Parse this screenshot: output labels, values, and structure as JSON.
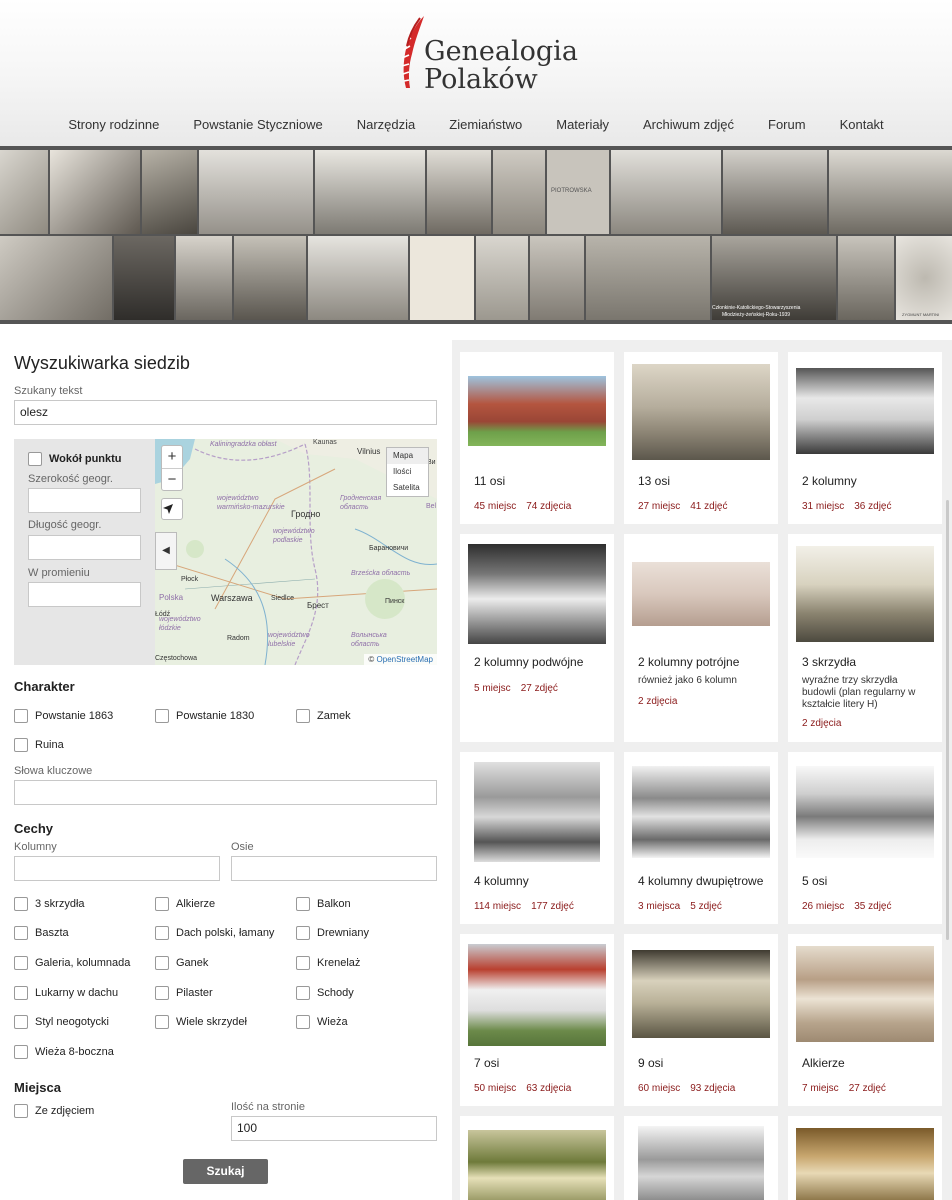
{
  "brand": {
    "line1": "Genealogia",
    "line2": "Polaków",
    "accent": "#d42a2a"
  },
  "nav": [
    "Strony rodzinne",
    "Powstanie Styczniowe",
    "Narzędzia",
    "Ziemiaństwo",
    "Materiały",
    "Archiwum zdjęć",
    "Forum",
    "Kontakt"
  ],
  "banner": {
    "caption_line1": "Członkinie-Katolickiego-Stowarzyszenia",
    "caption_line2": "Młodzieży-żeńskiej-Roku-1939",
    "stone_text": "PIOTROWSKA",
    "portrait_caption": "ZYGMUNT MARTINI"
  },
  "search": {
    "title": "Wyszukiwarka siedzib",
    "text_label": "Szukany tekst",
    "text_value": "olesz",
    "around_point": "Wokół punktu",
    "lat_label": "Szerokość geogr.",
    "lon_label": "Długość geogr.",
    "radius_label": "W promieniu"
  },
  "map": {
    "zoom_in": "+",
    "zoom_out": "−",
    "collapse": "◀",
    "layers": [
      "Mapa",
      "Ilości",
      "Satelita"
    ],
    "attribution_prefix": "©",
    "attribution_link": "OpenStreetMap",
    "places": [
      "Kaliningradzka obłast",
      "Kaunas",
      "Vilnius",
      "Ви",
      "województwo warmińsko-mazurskie",
      "Гродненская область",
      "Гродно",
      "województwo podlaskie",
      "Барановичи",
      "Płock",
      "Warszawa",
      "Brześcka область",
      "Polska",
      "Siedlce",
      "Брест",
      "Пинск",
      "województwo łódzkie",
      "Radom",
      "województwo lubelskie",
      "Волынська область",
      "Łódź",
      "Częstochowa",
      "Bel"
    ]
  },
  "character": {
    "title": "Charakter",
    "options": [
      "Powstanie 1863",
      "Powstanie 1830",
      "Zamek",
      "Ruina"
    ],
    "keywords_label": "Słowa kluczowe"
  },
  "features": {
    "title": "Cechy",
    "columns_label": "Kolumny",
    "axes_label": "Osie",
    "options": [
      "3 skrzydła",
      "Alkierze",
      "Balkon",
      "Baszta",
      "Dach polski, łamany",
      "Drewniany",
      "Galeria, kolumnada",
      "Ganek",
      "Krenelaż",
      "Lukarny w dachu",
      "Pilaster",
      "Schody",
      "Styl neogotycki",
      "Wiele skrzydeł",
      "Wieża",
      "Wieża 8-boczna"
    ]
  },
  "places": {
    "title": "Miejsca",
    "with_photo": "Ze zdjęciem",
    "per_page_label": "Ilość na stronie",
    "per_page_value": "100",
    "search_button": "Szukaj"
  },
  "results": [
    {
      "name": "11 osi",
      "places": "45 miejsc",
      "photos": "74 zdjęcia"
    },
    {
      "name": "13 osi",
      "places": "27 miejsc",
      "photos": "41 zdjęć"
    },
    {
      "name": "2 kolumny",
      "places": "31 miejsc",
      "photos": "36 zdjęć"
    },
    {
      "name": "2 kolumny podwójne",
      "places": "5 miejsc",
      "photos": "27 zdjęć"
    },
    {
      "name": "2 kolumny potrójne",
      "description": "również jako 6 kolumn",
      "photos": "2 zdjęcia"
    },
    {
      "name": "3 skrzydła",
      "description": "wyraźne trzy skrzydła budowli (plan regularny w kształcie litery H)",
      "photos": "2 zdjęcia"
    },
    {
      "name": "4 kolumny",
      "places": "114 miejsc",
      "photos": "177 zdjęć"
    },
    {
      "name": "4 kolumny dwupiętrowe",
      "places": "3 miejsca",
      "photos": "5 zdjęć"
    },
    {
      "name": "5 osi",
      "places": "26 miejsc",
      "photos": "35 zdjęć"
    },
    {
      "name": "7 osi",
      "places": "50 miejsc",
      "photos": "63 zdjęcia"
    },
    {
      "name": "9 osi",
      "places": "60 miejsc",
      "photos": "93 zdjęcia"
    },
    {
      "name": "Alkierze",
      "places": "7 miejsc",
      "photos": "27 zdjęć"
    }
  ]
}
